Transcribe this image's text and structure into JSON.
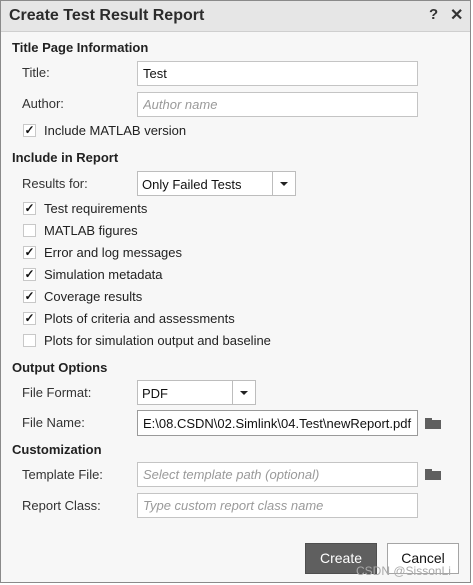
{
  "window": {
    "title": "Create Test Result Report",
    "help_glyph": "?",
    "close_glyph": "✕"
  },
  "title_page": {
    "section_label": "Title Page Information",
    "title_label": "Title:",
    "title_value": "Test",
    "author_label": "Author:",
    "author_placeholder": "Author name",
    "include_matlab_version": {
      "label": "Include MATLAB version",
      "checked": true
    }
  },
  "include_in_report": {
    "section_label": "Include in Report",
    "results_for_label": "Results for:",
    "results_for_value": "Only Failed Tests",
    "options": [
      {
        "label": "Test requirements",
        "checked": true
      },
      {
        "label": "MATLAB figures",
        "checked": false
      },
      {
        "label": "Error and log messages",
        "checked": true
      },
      {
        "label": "Simulation metadata",
        "checked": true
      },
      {
        "label": "Coverage results",
        "checked": true
      },
      {
        "label": "Plots of criteria and assessments",
        "checked": true
      },
      {
        "label": "Plots for simulation output and baseline",
        "checked": false
      }
    ]
  },
  "output_options": {
    "section_label": "Output Options",
    "file_format_label": "File Format:",
    "file_format_value": "PDF",
    "file_name_label": "File Name:",
    "file_name_value": "E:\\08.CSDN\\02.Simlink\\04.Test\\newReport.pdf"
  },
  "customization": {
    "section_label": "Customization",
    "template_file_label": "Template File:",
    "template_file_placeholder": "Select template path (optional)",
    "report_class_label": "Report Class:",
    "report_class_placeholder": "Type custom report class name"
  },
  "buttons": {
    "create": "Create",
    "cancel": "Cancel"
  },
  "watermark": "CSDN @SissonLi",
  "colors": {
    "primary_button": "#5f5f5f",
    "title_bar": "#e6e6e6",
    "dialog_bg": "#f7f7f7"
  }
}
